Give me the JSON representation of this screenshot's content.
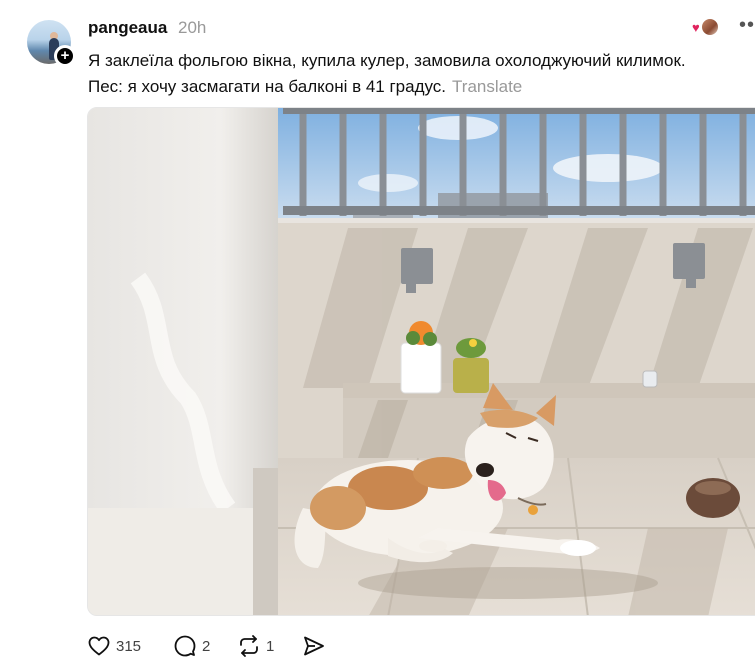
{
  "post": {
    "username": "pangeaua",
    "timestamp": "20h",
    "text_line1": "Я заклеїла фольгою вікна, купила кулер, замовила охолоджуючий килимок.",
    "text_line2": "Пес: я хочу засмагати на балконі в 41 градус.",
    "translate_label": "Translate"
  },
  "icons": {
    "avatar": "profile-avatar",
    "follow": "plus-icon",
    "more": "more-icon",
    "like": "heart-icon",
    "comment": "comment-icon",
    "repost": "repost-icon",
    "share": "share-icon"
  },
  "stats": {
    "likes": "315",
    "comments": "2",
    "reposts": "1"
  },
  "image": {
    "subject": "dog lying on sunny balcony",
    "colors": {
      "sky": "#9cc4e8",
      "wall": "#e9e6e1",
      "floor": "#d9d2c8",
      "shadow": "#bfb8ae"
    }
  }
}
